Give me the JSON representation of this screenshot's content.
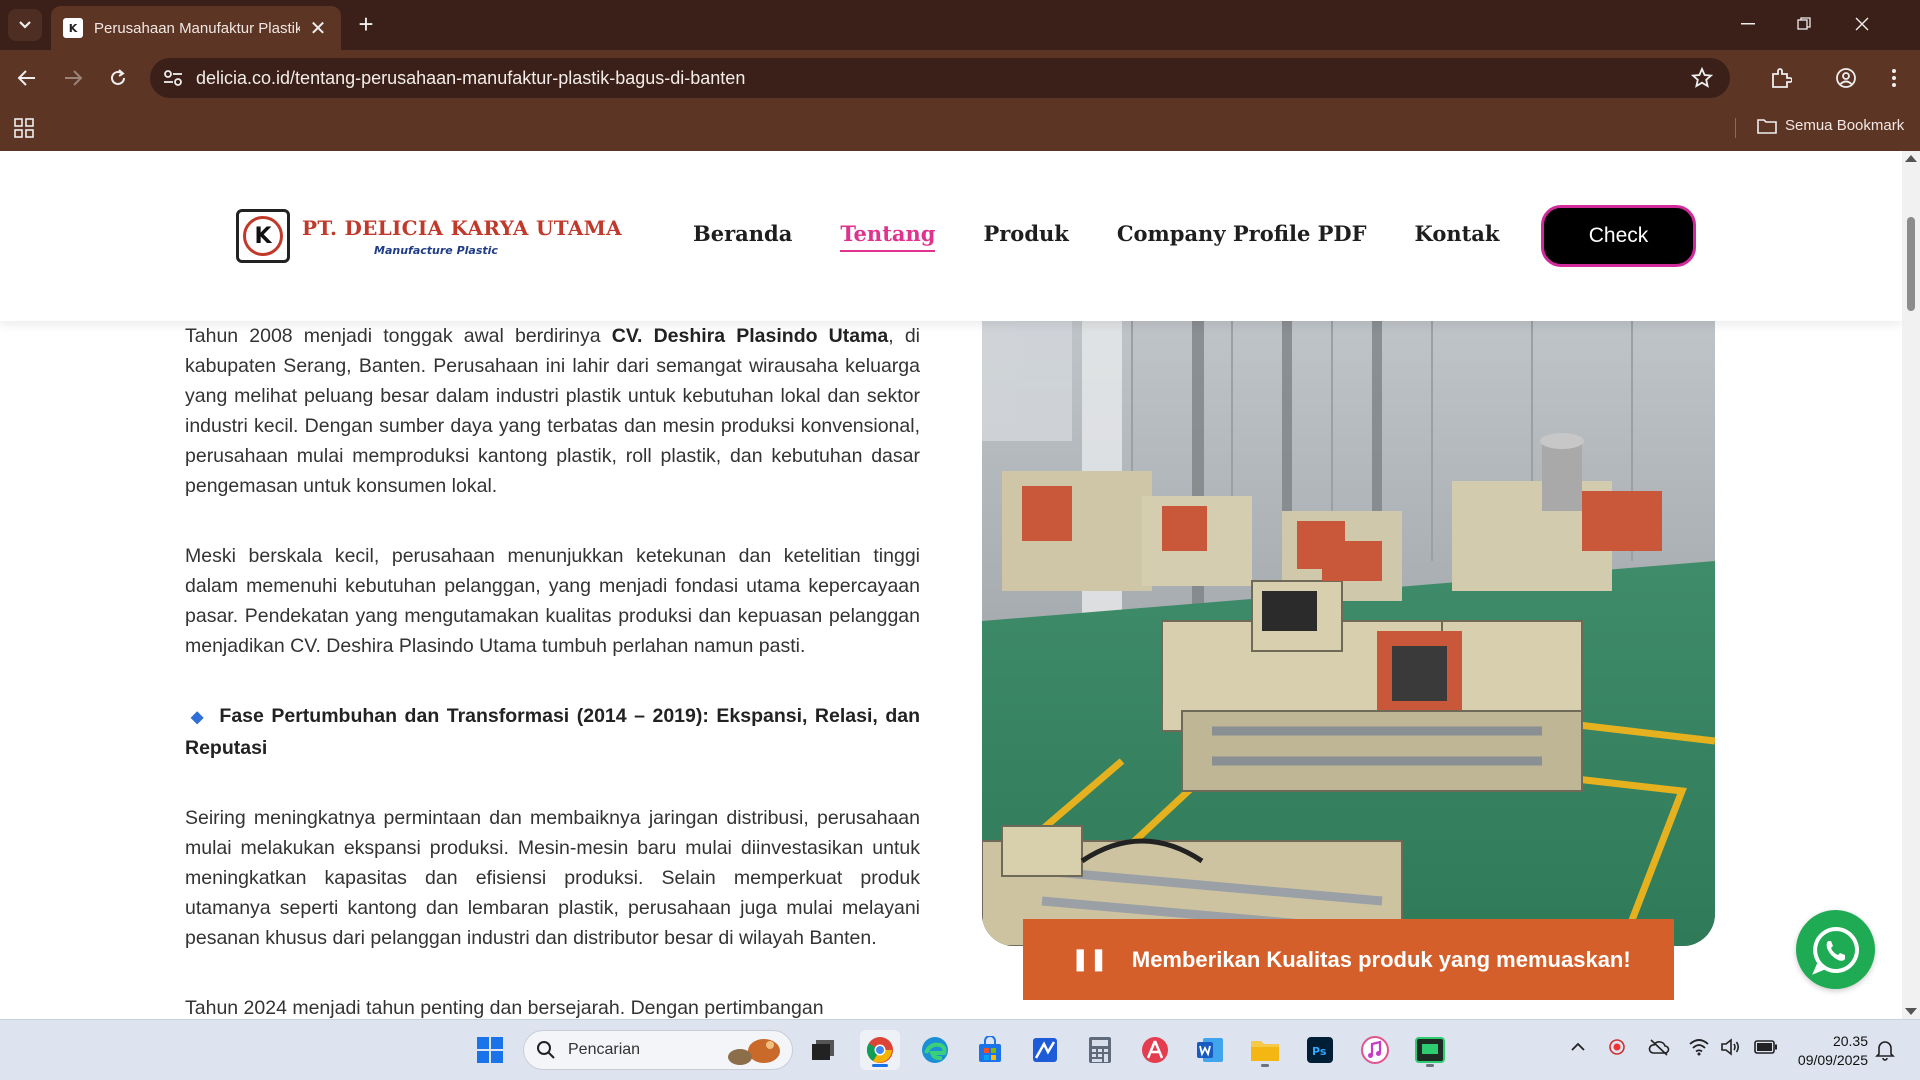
{
  "browser": {
    "tab_title": "Perusahaan Manufaktur Plastik",
    "tab_favicon": "K",
    "url": "delicia.co.id/tentang-perusahaan-manufaktur-plastik-bagus-di-banten",
    "bookmarks_label": "Semua Bookmark"
  },
  "site": {
    "logo_name": "PT. DELICIA KARYA UTAMA",
    "logo_tagline": "Manufacture Plastic",
    "logo_letter": "K",
    "nav": [
      {
        "label": "Beranda"
      },
      {
        "label": "Tentang"
      },
      {
        "label": "Produk"
      },
      {
        "label": "Company Profile PDF"
      },
      {
        "label": "Kontak"
      }
    ],
    "check_label": "Check",
    "accent_color": "#e0338e"
  },
  "article": {
    "p1_before": "Tahun 2008 menjadi tonggak awal berdirinya ",
    "p1_bold": "CV. Deshira Plasindo Utama",
    "p1_after": ", di kabupaten Serang, Banten. Perusahaan ini lahir dari semangat wirausaha keluarga yang melihat peluang besar dalam industri plastik untuk kebutuhan lokal dan sektor industri kecil. Dengan sumber daya yang terbatas dan mesin produksi konvensional, perusahaan mulai memproduksi kantong plastik, roll plastik, dan kebutuhan dasar pengemasan untuk konsumen lokal.",
    "p2": "Meski berskala kecil, perusahaan menunjukkan ketekunan dan ketelitian tinggi dalam memenuhi kebutuhan pelanggan, yang menjadi fondasi utama kepercayaan pasar. Pendekatan yang mengutamakan kualitas produksi dan kepuasan pelanggan menjadikan CV. Deshira Plasindo Utama tumbuh perlahan namun pasti.",
    "phase_heading": "Fase Pertumbuhan dan Transformasi (2014 – 2019): Ekspansi, Relasi, dan Reputasi",
    "p3": "Seiring meningkatnya permintaan dan membaiknya jaringan distribusi, perusahaan mulai melakukan ekspansi produksi. Mesin-mesin baru mulai diinvestasikan untuk meningkatkan kapasitas dan efisiensi produksi. Selain memperkuat produk utamanya seperti kantong dan lembaran plastik, perusahaan juga mulai melayani pesanan khusus dari pelanggan industri dan distributor besar di wilayah Banten.",
    "p4": "Tahun 2024 menjadi tahun penting dan bersejarah. Dengan pertimbangan"
  },
  "caption": {
    "text": "Memberikan Kualitas produk yang memuaskan!",
    "color": "#d45f2b"
  },
  "taskbar": {
    "search_placeholder": "Pencarian",
    "time": "20.35",
    "date": "09/09/2025"
  }
}
